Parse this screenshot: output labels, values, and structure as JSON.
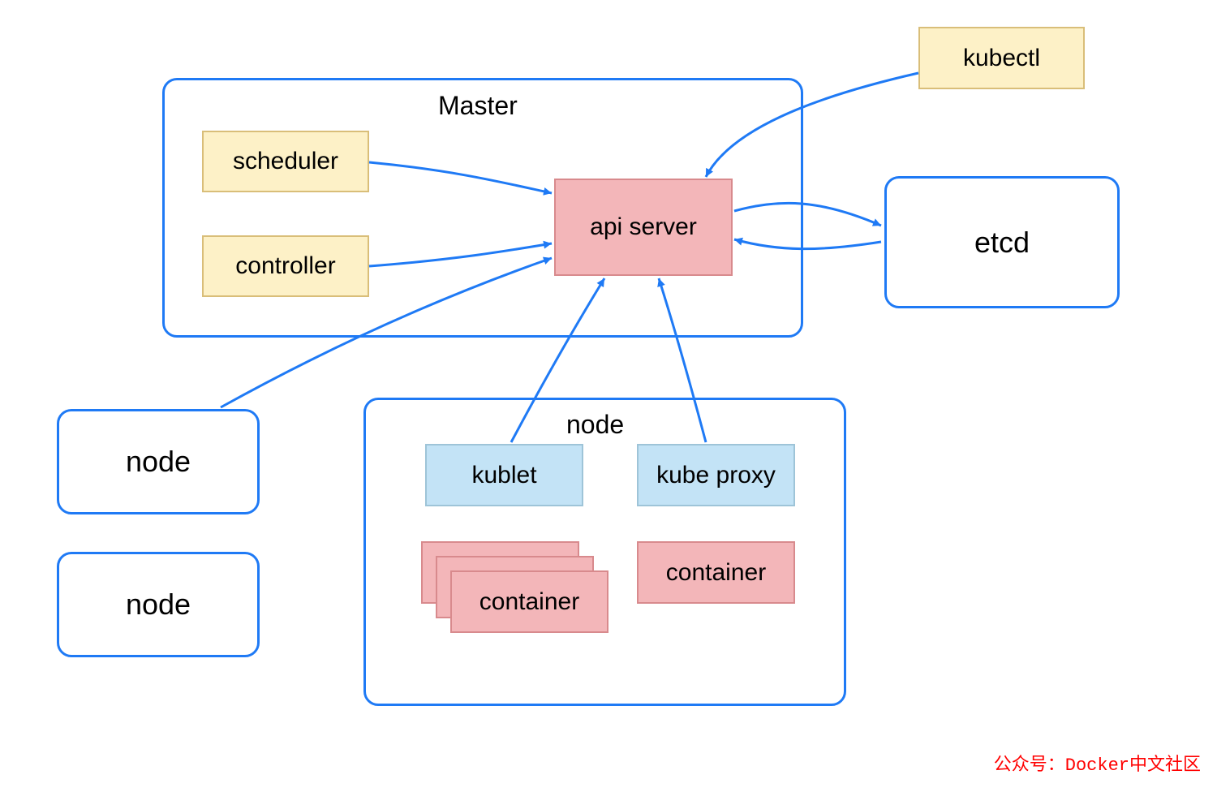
{
  "master": {
    "title": "Master",
    "scheduler": "scheduler",
    "controller": "controller",
    "api_server": "api server"
  },
  "kubectl": "kubectl",
  "etcd": "etcd",
  "node_detail": {
    "title": "node",
    "kublet": "kublet",
    "kube_proxy": "kube proxy",
    "container_stack": "container",
    "container_single": "container"
  },
  "nodes": {
    "node1": "node",
    "node2": "node"
  },
  "credit": "公众号：Docker中文社区",
  "colors": {
    "outline_border": "#1f7af5",
    "yellow_fill": "#fdf1c7",
    "pink_fill": "#f3b6b9",
    "blue_fill": "#c3e3f6",
    "arrow": "#1f7af5",
    "credit_text": "#ff0000"
  }
}
